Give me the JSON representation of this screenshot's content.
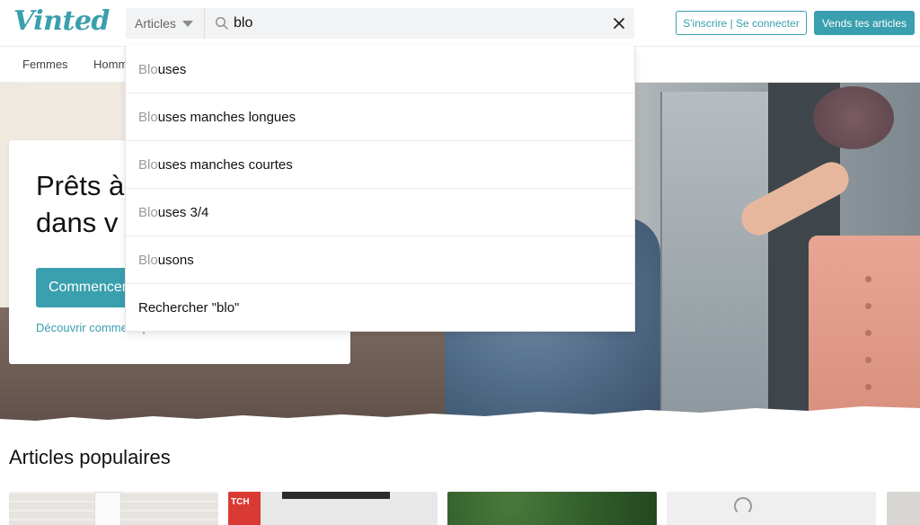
{
  "header": {
    "logo": "Vinted",
    "category_select": "Articles",
    "search_value": "blo",
    "auth_button": "S'inscrire | Se connecter",
    "sell_button": "Vends tes articles"
  },
  "nav": {
    "items": [
      "Femmes",
      "Homm"
    ]
  },
  "hero": {
    "title": "Prêts à\ndans v",
    "cta": "Commencer",
    "link": "Découvrir comment ça marche"
  },
  "dropdown": {
    "query_prefix": "Blo",
    "suggestions": [
      {
        "match": "Blo",
        "rest": "uses"
      },
      {
        "match": "Blo",
        "rest": "uses manches longues"
      },
      {
        "match": "Blo",
        "rest": "uses manches courtes"
      },
      {
        "match": "Blo",
        "rest": "uses 3/4"
      },
      {
        "match": "Blo",
        "rest": "usons"
      }
    ],
    "search_all": "Rechercher \"blo\""
  },
  "popular": {
    "title": "Articles populaires",
    "tile2_text": "TCH"
  },
  "colors": {
    "brand": "#3a9fae",
    "text": "#111111",
    "muted": "#9a9a9a"
  },
  "icons": {
    "search": "search-icon",
    "clear": "close-icon",
    "caret": "chevron-down-icon"
  }
}
